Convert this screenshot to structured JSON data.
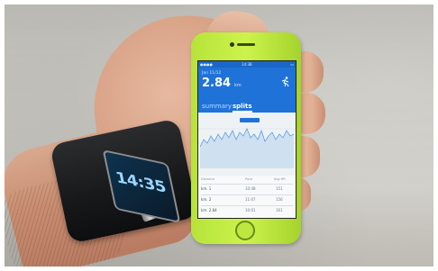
{
  "band": {
    "time": "14:35"
  },
  "phone": {
    "status": {
      "time": "14:38"
    },
    "header": {
      "date": "Jan 11/12",
      "distance": "2.84",
      "unit": "km"
    },
    "tabs": {
      "summary": "summary",
      "splits": "splits"
    },
    "table": {
      "headers": {
        "distance": "Distance",
        "pace": "Pace",
        "hr": "Avg HR"
      },
      "rows": [
        {
          "label": "km. 1",
          "pace": "10:48",
          "hr": "151"
        },
        {
          "label": "km. 2",
          "pace": "11:07",
          "hr": "156"
        },
        {
          "label": "km. 2.84",
          "pace": "10:01",
          "hr": "161"
        }
      ]
    },
    "colors": {
      "accent": "#1f73d8",
      "body": "#c2ee41"
    }
  }
}
